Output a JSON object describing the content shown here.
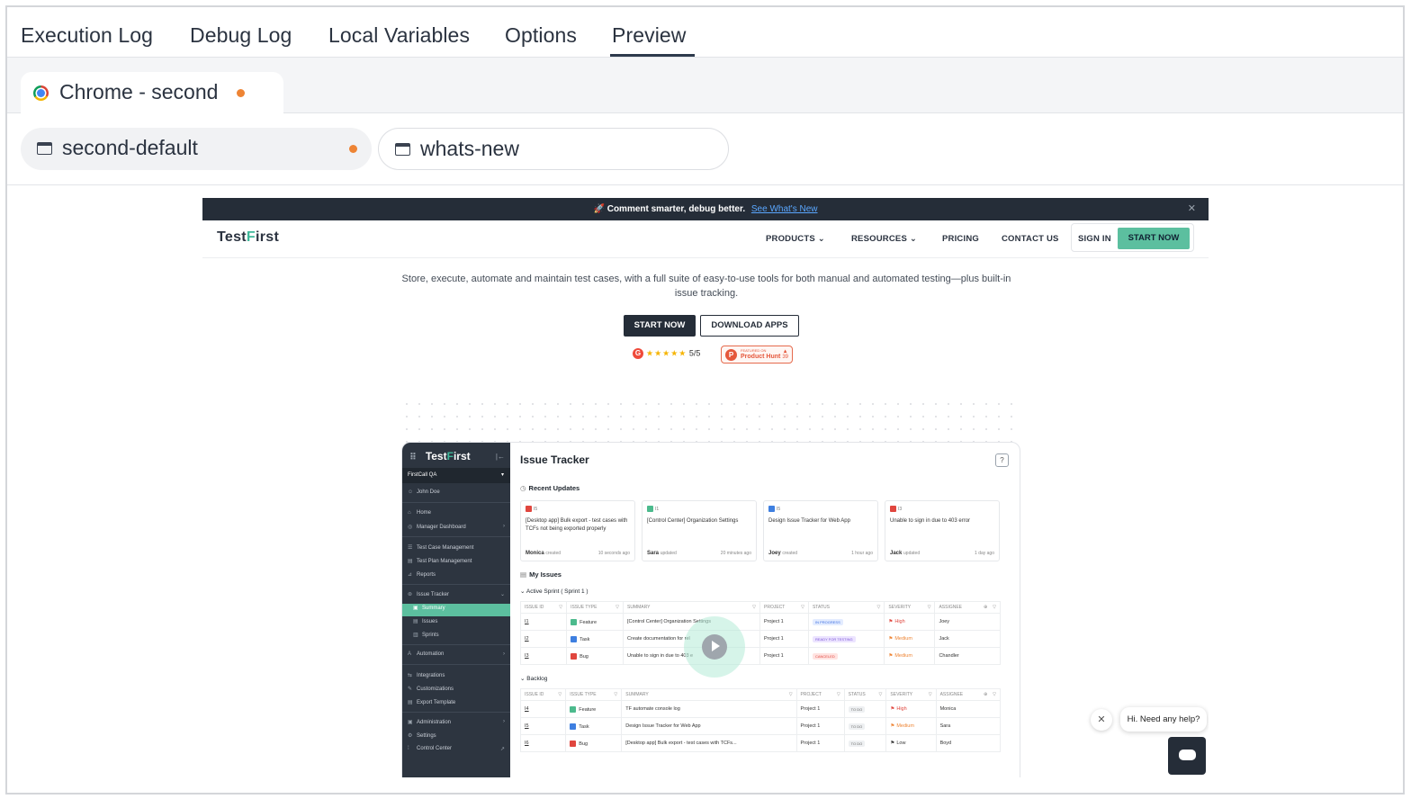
{
  "top_tabs": [
    "Execution Log",
    "Debug Log",
    "Local Variables",
    "Options",
    "Preview"
  ],
  "active_tab": "Preview",
  "browser_tab": {
    "label": "Chrome - second",
    "icon": "chrome-icon",
    "unsaved_dot_color": "#ee8434"
  },
  "windows": [
    {
      "label": "second-default",
      "icon": "window-icon",
      "active": true
    },
    {
      "label": "whats-new",
      "icon": "window-icon",
      "active": false
    }
  ],
  "preview": {
    "announcement": {
      "text": "🚀 Comment smarter, debug better.",
      "link": "See What's New",
      "close": "✕"
    },
    "logo": {
      "pre": "Test",
      "f": "F",
      "post": "irst"
    },
    "nav": {
      "products": "PRODUCTS",
      "resources": "RESOURCES",
      "pricing": "PRICING",
      "contact": "CONTACT US",
      "sign_in": "SIGN IN",
      "start_now": "START NOW"
    },
    "hero_text": "Store, execute, automate and maintain test cases, with a full suite of easy-to-use tools for both manual and automated testing—plus built-in issue tracking.",
    "btn_start": "START NOW",
    "btn_download": "DOWNLOAD APPS",
    "rating": {
      "g_icon": "G",
      "stars": "★★★★★",
      "score": "5/5"
    },
    "product_hunt": {
      "icon": "P",
      "small": "FEATURED ON",
      "label": "Product Hunt",
      "count": "39"
    },
    "app": {
      "sidebar": {
        "logo": {
          "pre": "Test",
          "f": "F",
          "post": "irst"
        },
        "workspace": "FirstCall QA",
        "user": "John Doe",
        "items": [
          "Home",
          "Manager Dashboard",
          "Test Case Management",
          "Test Plan Management",
          "Reports",
          "Issue Tracker",
          "Summary",
          "Issues",
          "Sprints",
          "Automation",
          "Integrations",
          "Customizations",
          "Export Template",
          "Administration",
          "Settings",
          "Control Center"
        ]
      },
      "title": "Issue Tracker",
      "recent_updates_title": "Recent Updates",
      "cards": [
        {
          "id": "I5",
          "color": "#e0463e",
          "text": "[Desktop app] Bulk export - test cases with TCFs not being exported properly",
          "who": "Monica",
          "action": "created",
          "when": "10 seconds ago"
        },
        {
          "id": "I1",
          "color": "#4cba8d",
          "text": "[Control Center] Organization Settings",
          "who": "Sara",
          "action": "updated",
          "when": "20 minutes ago"
        },
        {
          "id": "I5",
          "color": "#3e7fe0",
          "text": "Design Issue Tracker for Web App",
          "who": "Joey",
          "action": "created",
          "when": "1 hour ago"
        },
        {
          "id": "I3",
          "color": "#e0463e",
          "text": "Unable to sign in due to 403 error",
          "who": "Jack",
          "action": "updated",
          "when": "1 day ago"
        }
      ],
      "my_issues_title": "My Issues",
      "active_sprint_title": "Active Sprint ( Sprint 1 )",
      "backlog_title": "Backlog",
      "columns": [
        "ISSUE ID",
        "ISSUE TYPE",
        "SUMMARY",
        "PROJECT",
        "STATUS",
        "SEVERITY",
        "ASSIGNEE"
      ],
      "sprint_rows": [
        {
          "id": "I1",
          "type": "Feature",
          "type_color": "#4cba8d",
          "summary": "[Control Center] Organization Settings",
          "project": "Project 1",
          "status": "IN PROGRESS",
          "status_bg": "#e3ecff",
          "status_fg": "#3e6fe0",
          "severity": "High",
          "sev_color": "#e0463e",
          "assignee": "Joey"
        },
        {
          "id": "I2",
          "type": "Task",
          "type_color": "#3e7fe0",
          "summary": "Create documentation for rel",
          "project": "Project 1",
          "status": "READY FOR TESTING",
          "status_bg": "#ece4ff",
          "status_fg": "#7b55d6",
          "severity": "Medium",
          "sev_color": "#ee8434",
          "assignee": "Jack"
        },
        {
          "id": "I3",
          "type": "Bug",
          "type_color": "#e0463e",
          "summary": "Unable to sign in due to 403 e",
          "project": "Project 1",
          "status": "CANCELED",
          "status_bg": "#ffe3e1",
          "status_fg": "#e0463e",
          "severity": "Medium",
          "sev_color": "#ee8434",
          "assignee": "Chandler"
        }
      ],
      "backlog_rows": [
        {
          "id": "I4",
          "type": "Feature",
          "type_color": "#4cba8d",
          "summary": "TF automate console log",
          "project": "Project 1",
          "status": "TO DO",
          "status_bg": "#eef0f2",
          "status_fg": "#666",
          "severity": "High",
          "sev_color": "#e0463e",
          "assignee": "Monica"
        },
        {
          "id": "I5",
          "type": "Task",
          "type_color": "#3e7fe0",
          "summary": "Design Issue Tracker for Web App",
          "project": "Project 1",
          "status": "TO DO",
          "status_bg": "#eef0f2",
          "status_fg": "#666",
          "severity": "Medium",
          "sev_color": "#ee8434",
          "assignee": "Sara"
        },
        {
          "id": "I6",
          "type": "Bug",
          "type_color": "#e0463e",
          "summary": "[Desktop app] Bulk export - test cases with TCFs...",
          "project": "Project 1",
          "status": "TO DO",
          "status_bg": "#eef0f2",
          "status_fg": "#666",
          "severity": "Low",
          "sev_color": "#333",
          "assignee": "Boyd"
        }
      ]
    },
    "help": {
      "text": "Hi. Need any help?",
      "close": "✕"
    }
  }
}
